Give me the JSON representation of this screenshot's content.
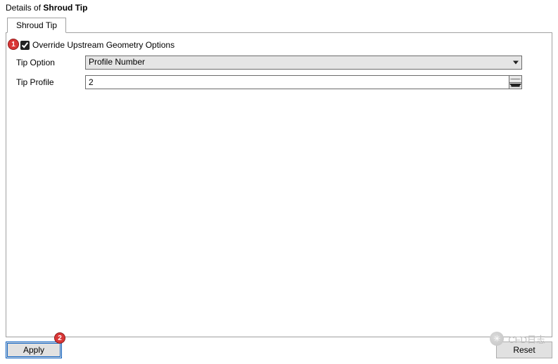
{
  "title": {
    "prefix": "Details of ",
    "object": "Shroud Tip"
  },
  "tab": {
    "label": "Shroud Tip"
  },
  "override": {
    "checked": true,
    "label": "Override Upstream Geometry Options"
  },
  "fields": {
    "tip_option": {
      "label": "Tip Option",
      "value": "Profile Number"
    },
    "tip_profile": {
      "label": "Tip Profile",
      "value": "2"
    }
  },
  "buttons": {
    "apply": "Apply",
    "reset": "Reset"
  },
  "callouts": {
    "one": "1",
    "two": "2"
  },
  "watermark": {
    "text": "CFD日志"
  }
}
